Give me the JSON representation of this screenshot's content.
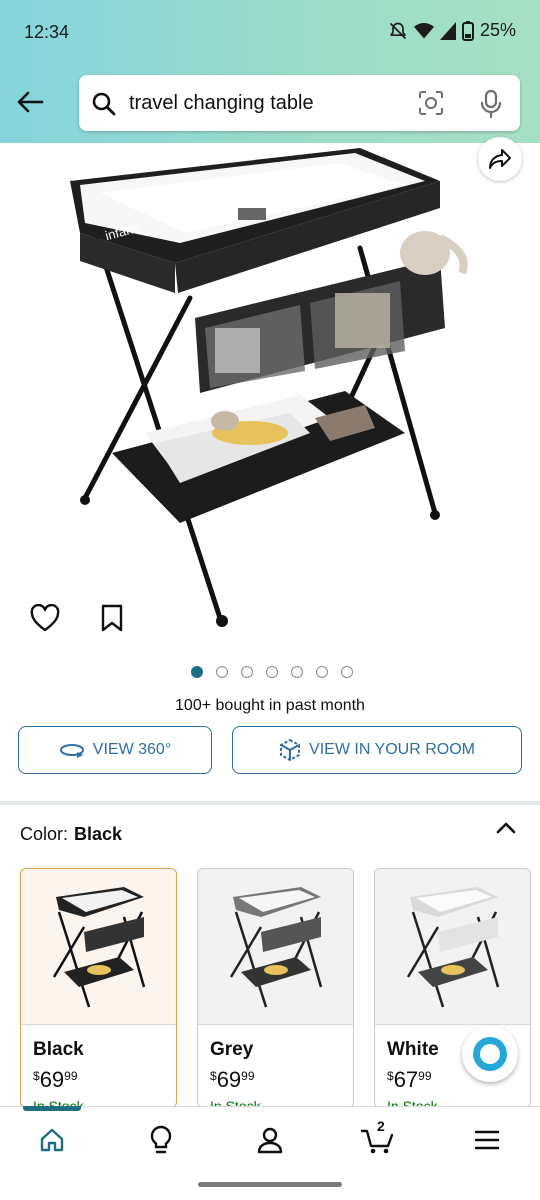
{
  "status_bar": {
    "time": "12:34",
    "battery": "25%"
  },
  "search": {
    "query": "travel changing table"
  },
  "product": {
    "image_brand": "infans",
    "bought_text": "100+ bought in past month",
    "carousel_count": 7,
    "carousel_active": 0
  },
  "buttons": {
    "view360": "VIEW 360°",
    "view_room": "VIEW IN YOUR ROOM"
  },
  "color": {
    "label": "Color:",
    "selected": "Black"
  },
  "swatches": [
    {
      "name": "Black",
      "currency": "$",
      "dollars": "69",
      "cents": "99",
      "stock": "In Stock"
    },
    {
      "name": "Grey",
      "currency": "$",
      "dollars": "69",
      "cents": "99",
      "stock": "In Stock"
    },
    {
      "name": "White",
      "currency": "$",
      "dollars": "67",
      "cents": "99",
      "stock": "In Stock"
    }
  ],
  "nav": {
    "cart_count": "2"
  },
  "colors": {
    "accent": "#1e6f82",
    "link": "#2d6ea3",
    "stock": "#007600",
    "selected_border": "#e0a052"
  }
}
